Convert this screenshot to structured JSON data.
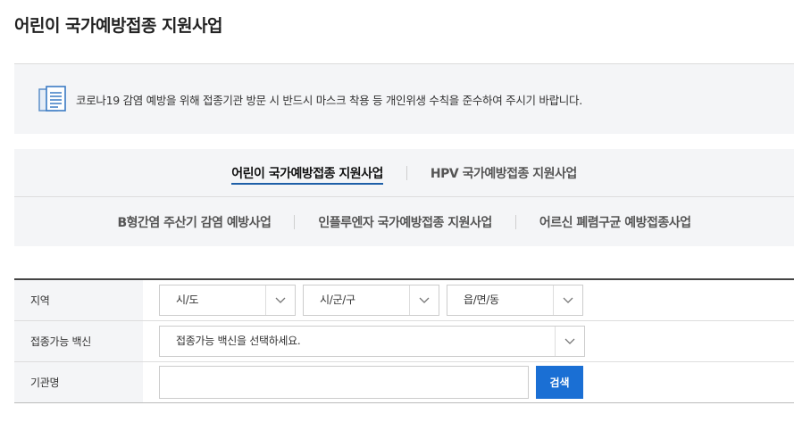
{
  "page": {
    "title": "어린이 국가예방접종 지원사업"
  },
  "notice": {
    "text": "코로나19 감염 예방을 위해 접종기관 방문 시 반드시 마스크 착용 등 개인위생 수칙을 준수하여 주시기 바랍니다."
  },
  "tabs": {
    "row1": [
      {
        "label": "어린이 국가예방접종 지원사업",
        "active": true
      },
      {
        "label": "HPV 국가예방접종 지원사업",
        "active": false
      }
    ],
    "row2": [
      {
        "label": "B형간염 주산기 감염 예방사업",
        "active": false
      },
      {
        "label": "인플루엔자 국가예방접종 지원사업",
        "active": false
      },
      {
        "label": "어르신 폐렴구균 예방접종사업",
        "active": false
      }
    ]
  },
  "form": {
    "region": {
      "label": "지역",
      "sido": "시/도",
      "sigungu": "시/군/구",
      "eupmyeondong": "읍/면/동"
    },
    "vaccine": {
      "label": "접종가능 백신",
      "selected": "접종가능 백신을 선택하세요."
    },
    "institution": {
      "label": "기관명",
      "value": "",
      "search_button": "검색"
    }
  },
  "colors": {
    "accent": "#1a6fd4",
    "tab_underline": "#1e5fa8",
    "panel_bg": "#f4f5f7"
  }
}
